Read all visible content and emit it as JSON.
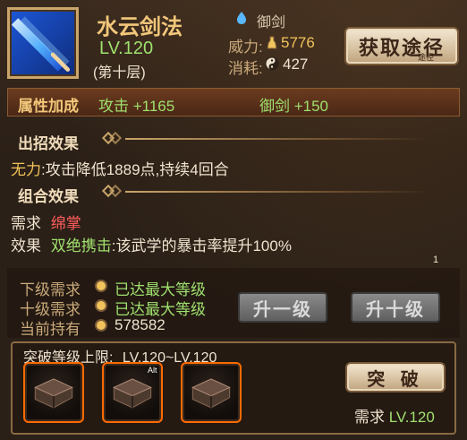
{
  "skill": {
    "name": "水云剑法",
    "level": "LV.120",
    "layer": "(第十层)",
    "tag": "御剑",
    "power_label": "威力:",
    "power_value": "5776",
    "cost_label": "消耗:",
    "cost_value": "427",
    "get_button": "获取途径",
    "get_button_sub": "途径"
  },
  "attributes": {
    "title": "属性加成",
    "attack": "攻击 +1165",
    "yujian": "御剑 +150"
  },
  "chuzhao": {
    "title": "出招效果",
    "prefix": "无力",
    "text": ":攻击降低1889点,持续4回合"
  },
  "zuhe": {
    "title": "组合效果",
    "need_label": "需求",
    "need_value": "绵掌",
    "effect_label": "效果",
    "effect_name": "双绝携击",
    "effect_text": ":该武学的暴击率提升100%"
  },
  "corner_number": "1",
  "requirements": {
    "next_label": "下级需求",
    "next_value": "已达最大等级",
    "ten_label": "十级需求",
    "ten_value": "已达最大等级",
    "hold_label": "当前持有",
    "hold_value": "578582",
    "btn_up1": "升一级",
    "btn_up10": "升十级"
  },
  "breakthrough": {
    "title": "突破等级上限:",
    "range": "LV.120~LV.120",
    "alt_badge": "Alt",
    "button": "突 破",
    "need_label": "需求",
    "need_value": "LV.120"
  },
  "colors": {
    "accent_gold": "#f2c77a",
    "accent_green": "#9fe06e",
    "accent_red": "#ff5c5c",
    "slot_border": "#ff6a00"
  }
}
